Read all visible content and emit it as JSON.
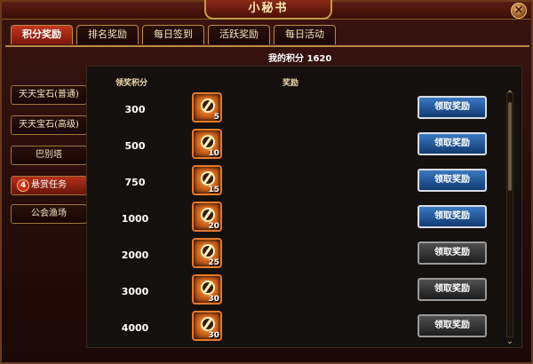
{
  "window": {
    "title": "小秘书",
    "close_symbol": "×"
  },
  "tabs": [
    {
      "label": "积分奖励",
      "active": true
    },
    {
      "label": "排名奖励",
      "active": false
    },
    {
      "label": "每日签到",
      "active": false
    },
    {
      "label": "活跃奖励",
      "active": false
    },
    {
      "label": "每日活动",
      "active": false
    }
  ],
  "sidebar": {
    "items": [
      {
        "label": "天天宝石(普通)"
      },
      {
        "label": "天天宝石(高级)"
      },
      {
        "label": "巴别塔"
      },
      {
        "label": "悬赏任务",
        "active": true,
        "badge": "4"
      },
      {
        "label": "公会渔场"
      }
    ]
  },
  "panel": {
    "score_label": "我的积分",
    "score_value": "1620",
    "col_points": "领奖积分",
    "col_reward": "奖励",
    "rows": [
      {
        "points": "300",
        "count": "5",
        "button": "领取奖励",
        "enabled": true
      },
      {
        "points": "500",
        "count": "10",
        "button": "领取奖励",
        "enabled": true
      },
      {
        "points": "750",
        "count": "15",
        "button": "领取奖励",
        "enabled": true
      },
      {
        "points": "1000",
        "count": "20",
        "button": "领取奖励",
        "enabled": true
      },
      {
        "points": "2000",
        "count": "25",
        "button": "领取奖励",
        "enabled": false
      },
      {
        "points": "3000",
        "count": "30",
        "button": "领取奖励",
        "enabled": false
      },
      {
        "points": "4000",
        "count": "30",
        "button": "领取奖励",
        "enabled": false
      }
    ]
  },
  "icons": {
    "reward_item": "gem-icon",
    "scroll_up": "chevron-up-icon",
    "scroll_down": "chevron-down-icon"
  },
  "colors": {
    "active_tab": "#c2371c",
    "claim_enabled": "#3a78c0",
    "claim_disabled": "#505050",
    "gold_border": "#b98a46"
  }
}
